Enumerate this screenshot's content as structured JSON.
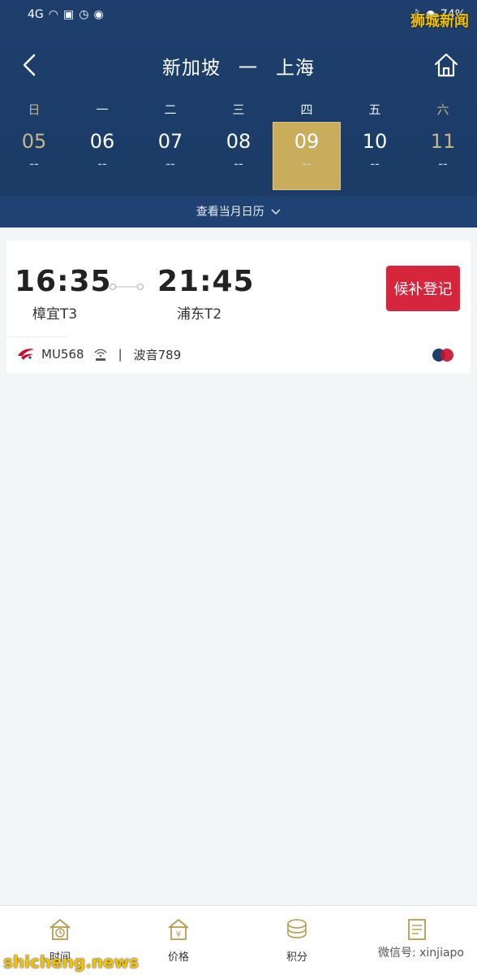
{
  "status_bar": {
    "network": "4G",
    "battery": "74%"
  },
  "watermark_top": "狮城新闻",
  "nav": {
    "origin": "新加坡",
    "separator": "一",
    "destination": "上海"
  },
  "week": [
    {
      "weekday": "日",
      "date": "05",
      "price": "--",
      "weekend": true,
      "selected": false
    },
    {
      "weekday": "一",
      "date": "06",
      "price": "--",
      "weekend": false,
      "selected": false
    },
    {
      "weekday": "二",
      "date": "07",
      "price": "--",
      "weekend": false,
      "selected": false
    },
    {
      "weekday": "三",
      "date": "08",
      "price": "--",
      "weekend": false,
      "selected": false
    },
    {
      "weekday": "四",
      "date": "09",
      "price": "--",
      "weekend": false,
      "selected": true
    },
    {
      "weekday": "五",
      "date": "10",
      "price": "--",
      "weekend": false,
      "selected": false
    },
    {
      "weekday": "六",
      "date": "11",
      "price": "--",
      "weekend": true,
      "selected": false
    }
  ],
  "calendar_link": "查看当月日历",
  "flight": {
    "dep_time": "16:35",
    "dep_airport": "樟宜T3",
    "arr_time": "21:45",
    "arr_airport": "浦东T2",
    "action": "候补登记",
    "flight_no": "MU568",
    "separator": "|",
    "aircraft": "波音789"
  },
  "tabs": [
    {
      "label": "时间",
      "icon": "clock-house-icon"
    },
    {
      "label": "价格",
      "icon": "price-house-icon"
    },
    {
      "label": "积分",
      "icon": "coins-icon"
    },
    {
      "label": "",
      "icon": "tax-note-icon"
    }
  ],
  "watermark_bottom_left": "shicheng.news",
  "watermark_bottom_right": "微信号: xinjiapo",
  "colors": {
    "header": "#1e3f6d",
    "selected": "#c9ac5c",
    "action": "#d6263b"
  }
}
